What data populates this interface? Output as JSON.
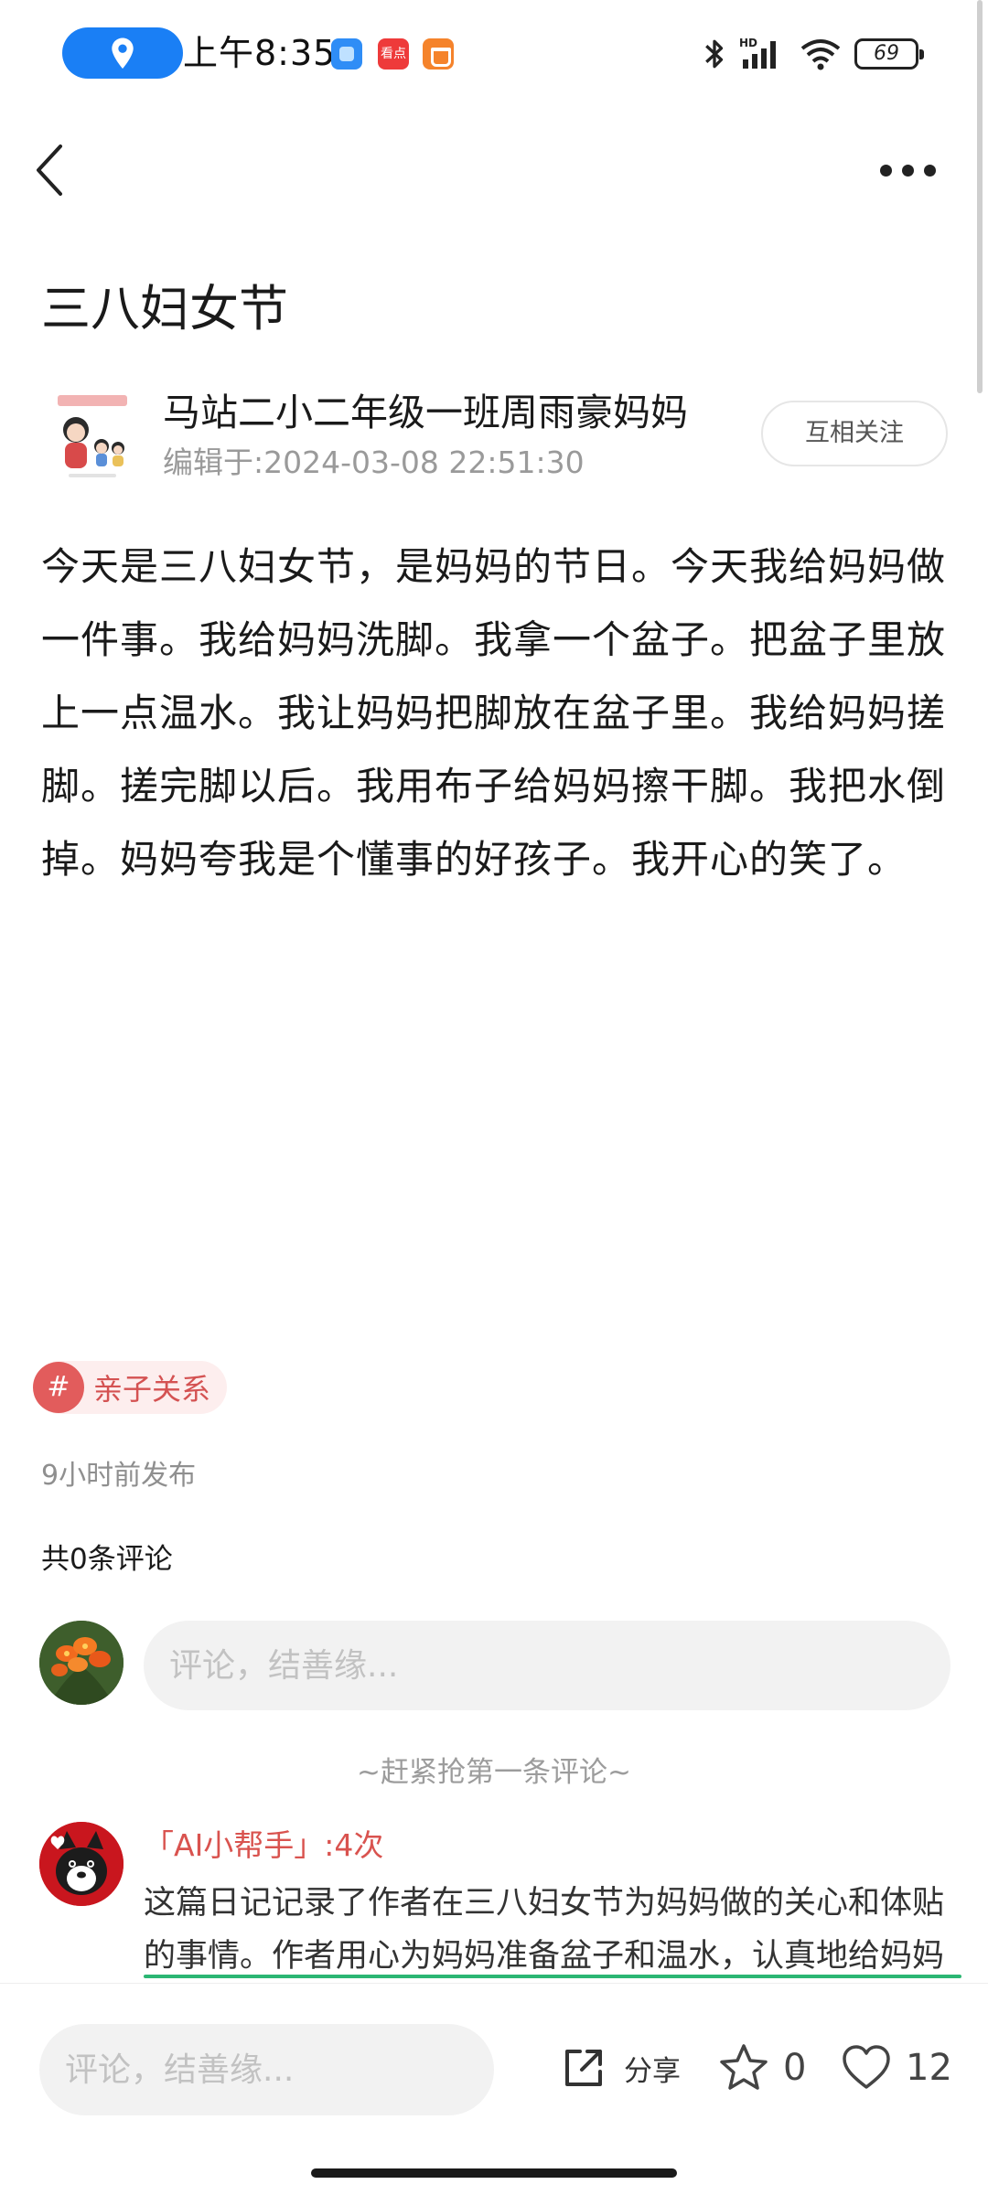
{
  "status_bar": {
    "time": "上午8:35",
    "notif_app_2": "看点",
    "battery": "69",
    "network": "HD"
  },
  "nav": {
    "back_icon": "chevron-left-icon",
    "more_icon": "more-horizontal-icon"
  },
  "article": {
    "title": "三八妇女节",
    "author": "马站二小二年级一班周雨豪妈妈",
    "edit_time": "编辑于:2024-03-08 22:51:30",
    "follow_label": "互相关注",
    "body": "今天是三八妇女节，是妈妈的节日。今天我给妈妈做一件事。我给妈妈洗脚。我拿一个盆子。把盆子里放上一点温水。我让妈妈把脚放在盆子里。我给妈妈搓脚。搓完脚以后。我用布子给妈妈擦干脚。我把水倒掉。妈妈夸我是个懂事的好孩子。我开心的笑了。"
  },
  "tag": {
    "hash": "#",
    "label": "亲子关系"
  },
  "meta": {
    "publish_time": "9小时前发布",
    "comment_count": "共0条评论"
  },
  "comment_box": {
    "placeholder": "评论，结善缘..."
  },
  "first_comment_hint": "~赶紧抢第一条评论~",
  "ai_helper": {
    "name": "「AI小帮手」:4次",
    "text": "这篇日记记录了作者在三八妇女节为妈妈做的关心和体贴的事情。作者用心为妈妈准备盆子和温水，认真地给妈妈"
  },
  "bottom_bar": {
    "placeholder": "评论，结善缘...",
    "share_label": "分享",
    "favorite_count": "0",
    "like_count": "12"
  },
  "colors": {
    "accent_blue": "#1a7ff5",
    "tag_red": "#e25c5c",
    "ai_name_red": "#d9534f",
    "underline_green": "#2bb673"
  }
}
